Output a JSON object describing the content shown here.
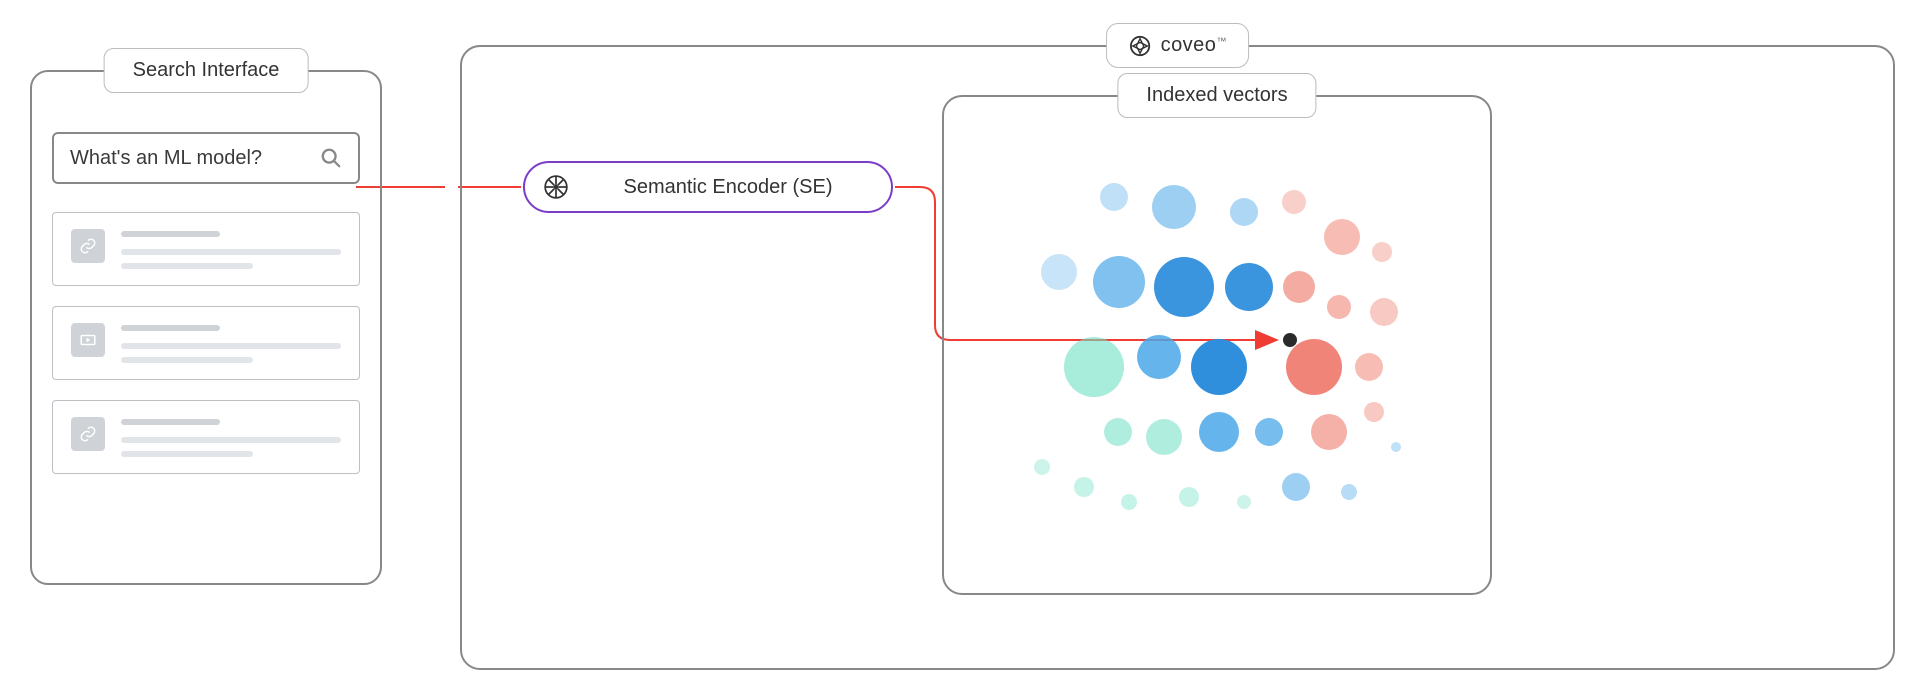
{
  "searchInterface": {
    "label": "Search Interface",
    "query": "What's an ML model?"
  },
  "platform": {
    "brand": "coveo",
    "tm": "™"
  },
  "encoder": {
    "label": "Semantic Encoder (SE)"
  },
  "vectors": {
    "label": "Indexed vectors"
  },
  "colors": {
    "encoderBorder": "#7a3cc9",
    "connector": "#ef3d33",
    "panelBorder": "#888888"
  }
}
